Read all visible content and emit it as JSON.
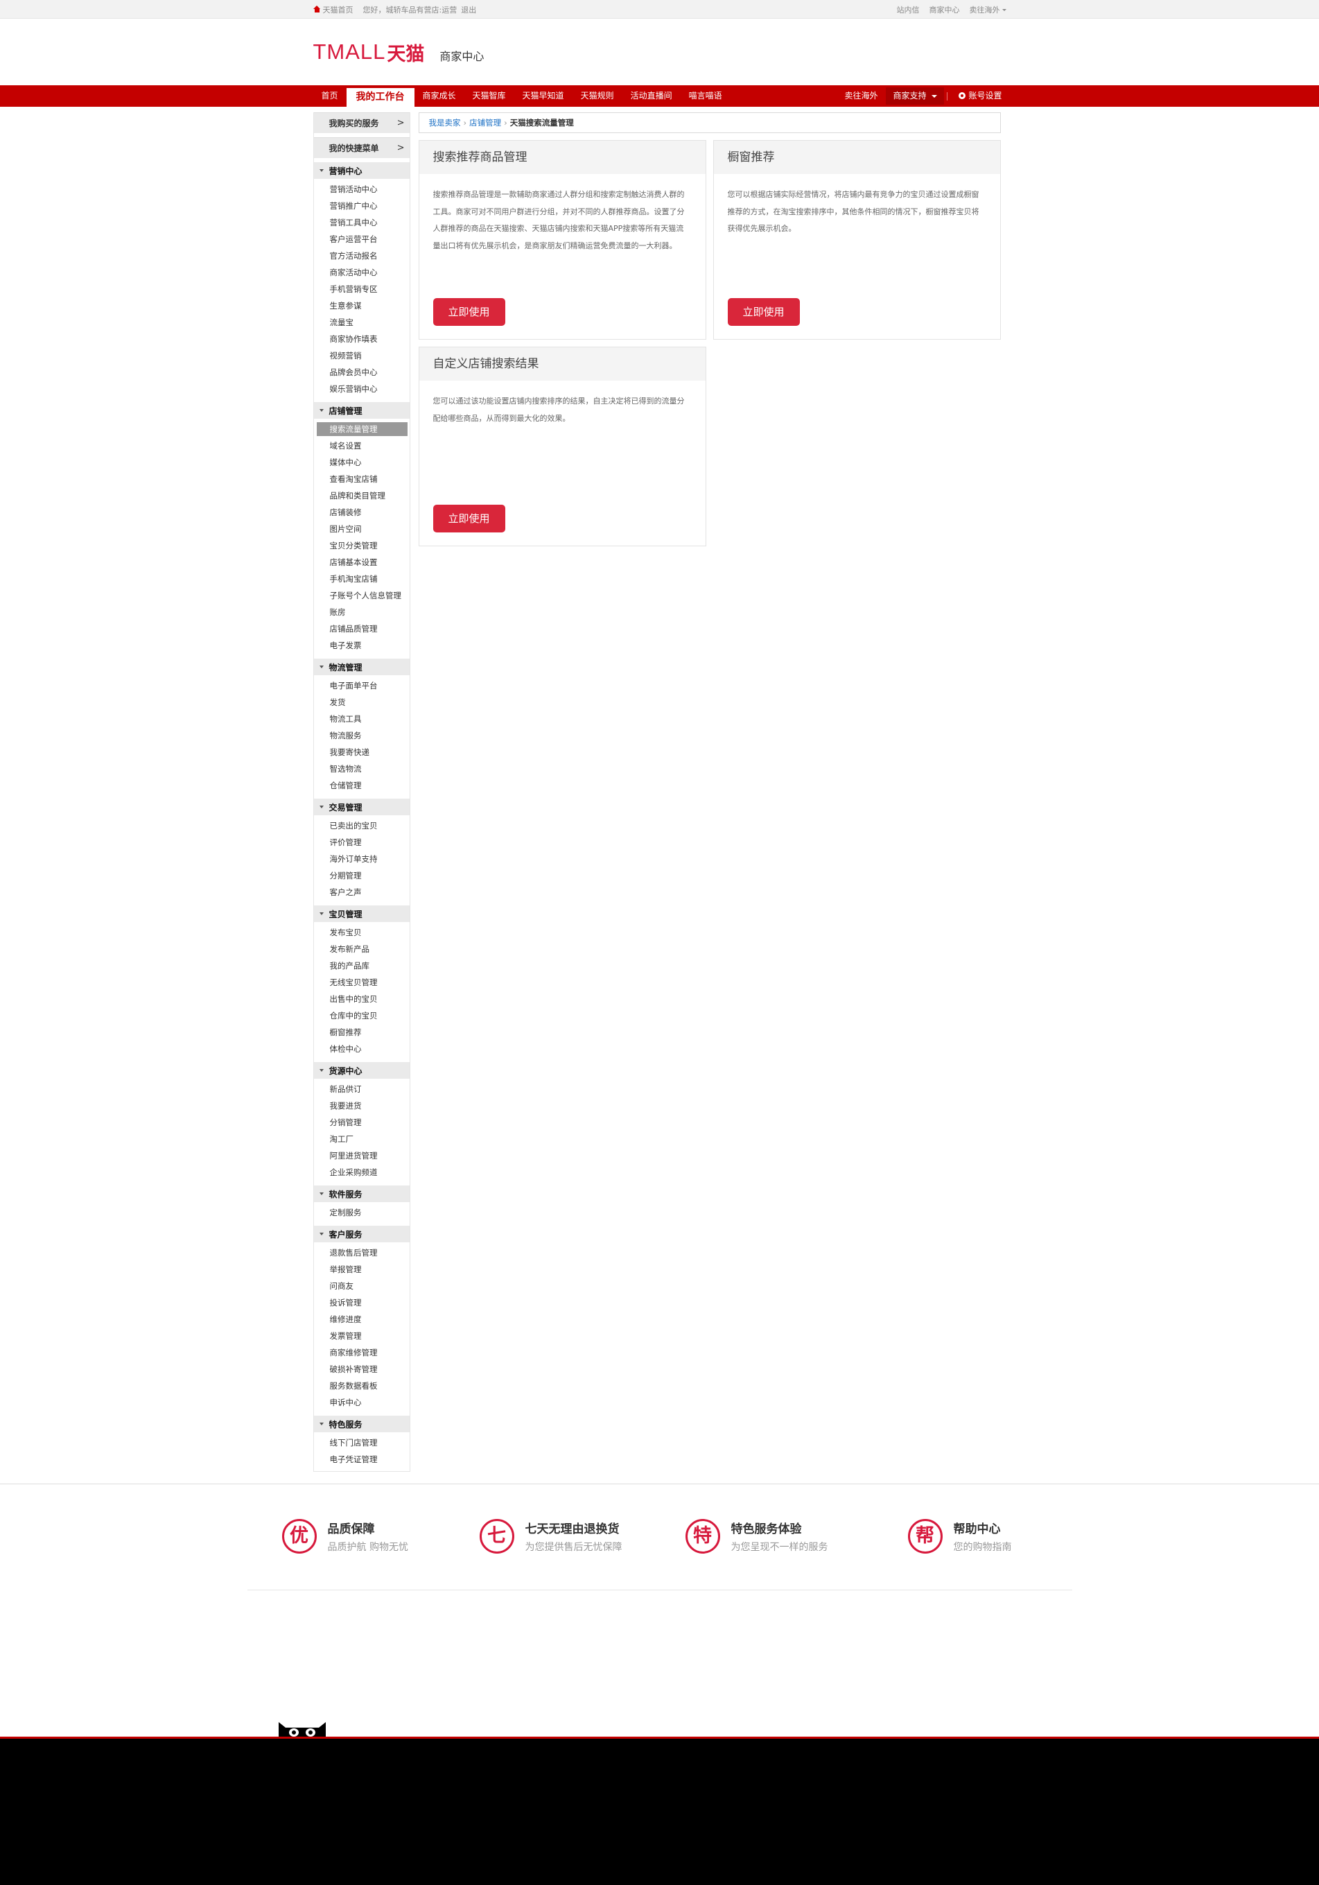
{
  "topbar": {
    "home": "天猫首页",
    "greeting": "您好，城轿车品有营店:运营",
    "logout": "退出",
    "right": [
      "站内信",
      "商家中心",
      "卖往海外"
    ]
  },
  "header": {
    "logo_text": "TMALL",
    "logo_cn": "天猫",
    "subtitle": "商家中心"
  },
  "nav": {
    "items": [
      "首页",
      "我的工作台",
      "商家成长",
      "天猫智库",
      "天猫早知道",
      "天猫规则",
      "活动直播间",
      "喵言喵语"
    ],
    "right": {
      "sell_abroad": "卖往海外",
      "support": "商家支持",
      "account": "账号设置"
    }
  },
  "sidebar": {
    "quick": [
      {
        "label": "我购买的服务",
        "arrow": ">"
      },
      {
        "label": "我的快捷菜单",
        "arrow": ">"
      }
    ],
    "groups": [
      {
        "title": "营销中心",
        "items": [
          "营销活动中心",
          "营销推广中心",
          "营销工具中心",
          "客户运营平台",
          "官方活动报名",
          "商家活动中心",
          "手机营销专区",
          "生意参谋",
          "流量宝",
          "商家协作填表",
          "视频营销",
          "品牌会员中心",
          "娱乐营销中心"
        ]
      },
      {
        "title": "店铺管理",
        "items": [
          "搜索流量管理",
          "域名设置",
          "媒体中心",
          "查看淘宝店铺",
          "品牌和类目管理",
          "店铺装修",
          "图片空间",
          "宝贝分类管理",
          "店铺基本设置",
          "手机淘宝店铺",
          "子账号个人信息管理",
          "账房",
          "店铺品质管理",
          "电子发票"
        ]
      },
      {
        "title": "物流管理",
        "items": [
          "电子面单平台",
          "发货",
          "物流工具",
          "物流服务",
          "我要寄快递",
          "智选物流",
          "仓储管理"
        ]
      },
      {
        "title": "交易管理",
        "items": [
          "已卖出的宝贝",
          "评价管理",
          "海外订单支持",
          "分期管理",
          "客户之声"
        ]
      },
      {
        "title": "宝贝管理",
        "items": [
          "发布宝贝",
          "发布新产品",
          "我的产品库",
          "无线宝贝管理",
          "出售中的宝贝",
          "仓库中的宝贝",
          "橱窗推荐",
          "体检中心"
        ]
      },
      {
        "title": "货源中心",
        "items": [
          "新品供订",
          "我要进货",
          "分销管理",
          "淘工厂",
          "阿里进货管理",
          "企业采购频道"
        ]
      },
      {
        "title": "软件服务",
        "items": [
          "定制服务"
        ]
      },
      {
        "title": "客户服务",
        "items": [
          "退款售后管理",
          "举报管理",
          "问商友",
          "投诉管理",
          "维修进度",
          "发票管理",
          "商家维修管理",
          "破损补寄管理",
          "服务数据看板",
          "申诉中心"
        ]
      },
      {
        "title": "特色服务",
        "items": [
          "线下门店管理",
          "电子凭证管理"
        ]
      }
    ],
    "selected": "搜索流量管理"
  },
  "breadcrumb": [
    "我是卖家",
    "店铺管理",
    "天猫搜索流量管理"
  ],
  "cards": [
    {
      "title": "搜索推荐商品管理",
      "desc": "搜索推荐商品管理是一款辅助商家通过人群分组和搜索定制触达消费人群的工具。商家可对不同用户群进行分组，并对不同的人群推荐商品。设置了分人群推荐的商品在天猫搜索、天猫店铺内搜索和天猫APP搜索等所有天猫流量出口将有优先展示机会，是商家朋友们精确运营免费流量的一大利器。",
      "button": "立即使用"
    },
    {
      "title": "橱窗推荐",
      "desc": "您可以根据店铺实际经营情况，将店铺内最有竞争力的宝贝通过设置成橱窗推荐的方式，在淘宝搜索排序中，其他条件相同的情况下，橱窗推荐宝贝将获得优先展示机会。",
      "button": "立即使用"
    },
    {
      "title": "自定义店铺搜索结果",
      "desc": "您可以通过该功能设置店铺内搜索排序的结果，自主决定将已得到的流量分配给哪些商品，从而得到最大化的效果。",
      "button": "立即使用"
    }
  ],
  "services": [
    {
      "icon": "优",
      "title": "品质保障",
      "sub": "品质护航 购物无忧"
    },
    {
      "icon": "七",
      "title": "七天无理由退换货",
      "sub": "为您提供售后无忧保障"
    },
    {
      "icon": "特",
      "title": "特色服务体验",
      "sub": "为您呈现不一样的服务"
    },
    {
      "icon": "帮",
      "title": "帮助中心",
      "sub": "您的购物指南"
    }
  ],
  "colors": {
    "brand": "#c40000",
    "button": "#d9263a",
    "link": "#1a6fc4"
  }
}
